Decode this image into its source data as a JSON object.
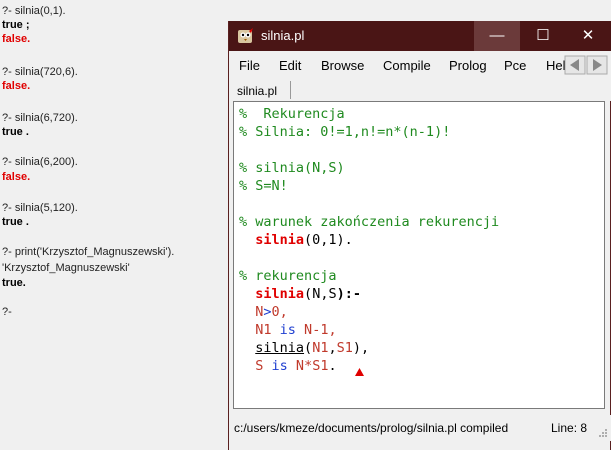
{
  "console": {
    "lines": [
      {
        "text": "?- silnia(0,1).",
        "kind": "query"
      },
      {
        "text": "true ;",
        "kind": "true"
      },
      {
        "text": "false.",
        "kind": "false"
      },
      {
        "text": "?- silnia(720,6).",
        "kind": "query"
      },
      {
        "text": "false.",
        "kind": "false"
      },
      {
        "text": "?- silnia(6,720).",
        "kind": "query"
      },
      {
        "text": "true .",
        "kind": "true"
      },
      {
        "text": "?- silnia(6,200).",
        "kind": "query"
      },
      {
        "text": "false.",
        "kind": "false"
      },
      {
        "text": "?- silnia(5,120).",
        "kind": "query"
      },
      {
        "text": "true .",
        "kind": "true"
      },
      {
        "text": "?- print('Krzysztof_Magnuszewski').",
        "kind": "query"
      },
      {
        "text": "'Krzysztof_Magnuszewski'",
        "kind": "query"
      },
      {
        "text": "true.",
        "kind": "true"
      },
      {
        "text": "?-",
        "kind": "query"
      }
    ]
  },
  "window": {
    "title": "silnia.pl",
    "minimize_glyph": "—",
    "maximize_glyph": "☐",
    "close_glyph": "✕",
    "accent_color": "#4a1515"
  },
  "menu": {
    "items": [
      "File",
      "Edit",
      "Browse",
      "Compile",
      "Prolog",
      "Pce",
      "Hel"
    ]
  },
  "tab": {
    "label": "silnia.pl"
  },
  "code": {
    "l1": "%  Rekurencja",
    "l2": "% Silnia: 0!=1,n!=n*(n-1)!",
    "l3": "% silnia(N,S)",
    "l4": "% S=N!",
    "l5": "% warunek zakończenia rekurencji",
    "l6_head": "silnia",
    "l6_rest": "(0,1).",
    "l7": "% rekurencja",
    "l8_head": "silnia",
    "l8_open": "(",
    "l8_n": "N",
    "l8_comma": ",",
    "l8_s": "S",
    "l8_close": "):-",
    "l9_n": "N",
    "l9_op": ">",
    "l9_rest": "0,",
    "l10_n1": "N1",
    "l10_is": " is ",
    "l10_n": "N",
    "l10_rest": "-1,",
    "l11_call": "silnia",
    "l11_open": "(",
    "l11_n1": "N1",
    "l11_comma": ",",
    "l11_s1": "S1",
    "l11_close": "),",
    "l12_s": "S",
    "l12_is": " is ",
    "l12_n": "N",
    "l12_star": "*",
    "l12_s1": "S1",
    "l12_end": "."
  },
  "status": {
    "message": "c:/users/kmeze/documents/prolog/silnia.pl compiled",
    "line": "Line: 8"
  }
}
